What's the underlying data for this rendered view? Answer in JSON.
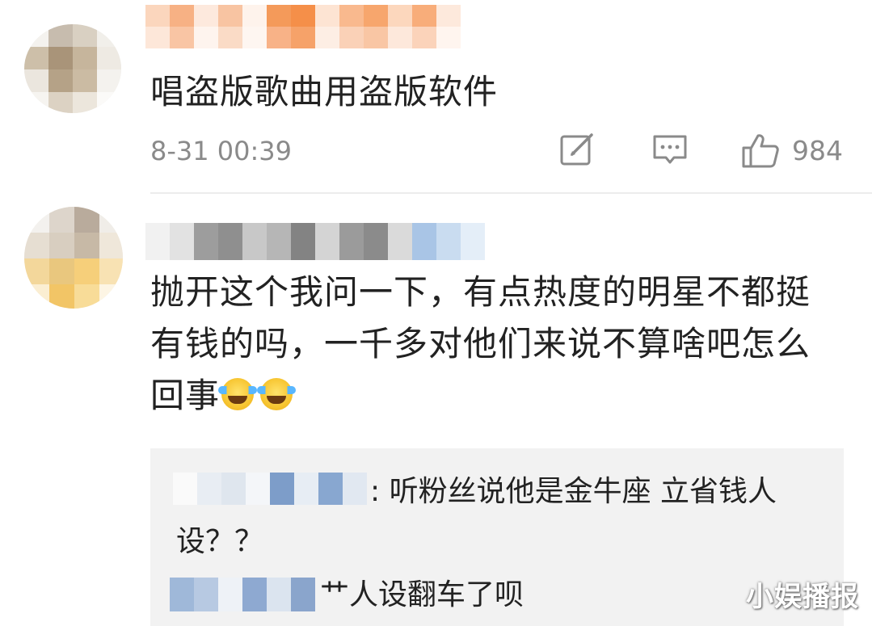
{
  "comments": [
    {
      "text": "唱盗版歌曲用盗版软件",
      "time": "8-31 00:39",
      "likes": "984",
      "actions": {
        "repost_icon": "edit-share-icon",
        "comment_icon": "comment-icon",
        "like_icon": "thumbs-up-icon"
      }
    },
    {
      "text_line1": "抛开这个我问一下，有点热度的明星不都挺",
      "text_line2": "有钱的吗，一千多对他们来说不算啥吧怎么",
      "text_line3": "回事",
      "emoji": [
        "laugh-cry-emoji",
        "laugh-cry-emoji"
      ],
      "replies": [
        {
          "separator": ":",
          "text_line1": " 听粉丝说他是金牛座 立省钱人",
          "text_line2": "设？？"
        },
        {
          "text": "艹人设翻车了呗"
        }
      ]
    }
  ],
  "watermark": "小娱播报",
  "colors": {
    "meta_gray": "#8a8a8a",
    "reply_bg": "#f2f2f2",
    "mask_orange": "#f59b4a",
    "mask_blue": "#8fb3db"
  }
}
